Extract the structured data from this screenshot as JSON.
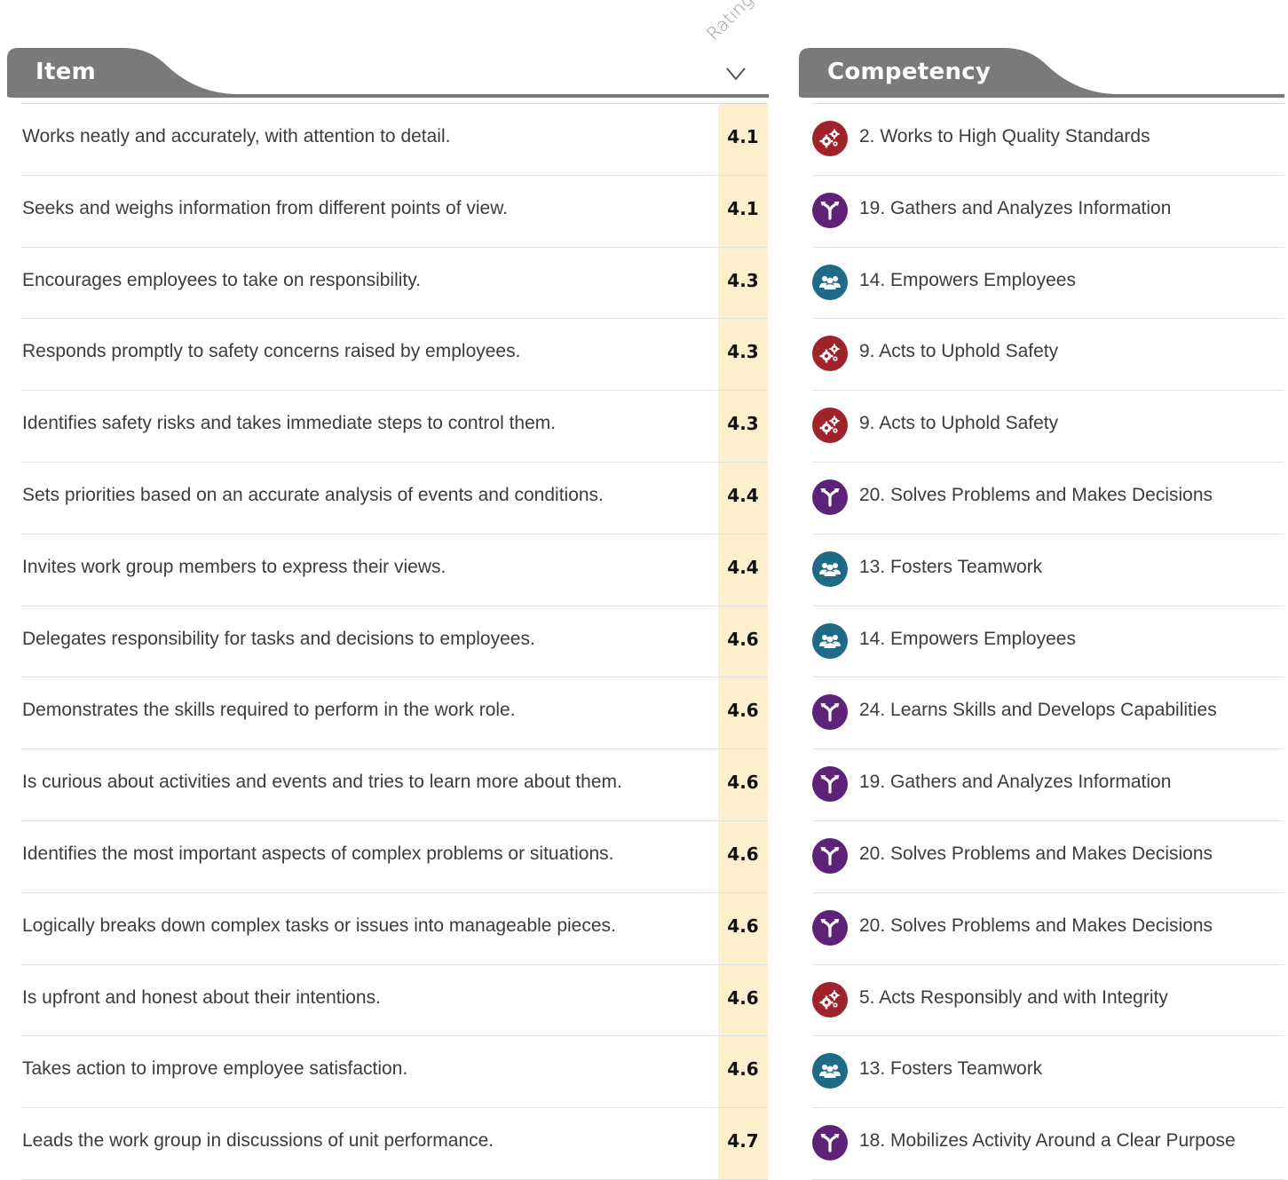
{
  "header": {
    "item_title": "Item",
    "competency_title": "Competency",
    "rating_label": "Rating",
    "sort_icon": "chevron-down-icon"
  },
  "colors": {
    "tab_gray": "#7a7a7a",
    "rating_highlight": "#fdefcc",
    "quality": "#a0222b",
    "thinking": "#5e2379",
    "people": "#1e6a87"
  },
  "rows": [
    {
      "item": "Works neatly and accurately, with attention to detail.",
      "rating": "4.1",
      "competency": "2. Works to High Quality Standards",
      "icon": "gears-icon",
      "category": "quality"
    },
    {
      "item": "Seeks and weighs information from different points of view.",
      "rating": "4.1",
      "competency": "19. Gathers and Analyzes Information",
      "icon": "fork-icon",
      "category": "thinking"
    },
    {
      "item": "Encourages employees to take on responsibility.",
      "rating": "4.3",
      "competency": "14. Empowers Employees",
      "icon": "people-icon",
      "category": "people"
    },
    {
      "item": "Responds promptly to safety concerns raised by employees.",
      "rating": "4.3",
      "competency": "9. Acts to Uphold Safety",
      "icon": "gears-icon",
      "category": "quality"
    },
    {
      "item": "Identifies safety risks and takes immediate steps to control them.",
      "rating": "4.3",
      "competency": "9. Acts to Uphold Safety",
      "icon": "gears-icon",
      "category": "quality"
    },
    {
      "item": "Sets priorities based on an accurate analysis of events and conditions.",
      "rating": "4.4",
      "competency": "20. Solves Problems and Makes Decisions",
      "icon": "fork-icon",
      "category": "thinking"
    },
    {
      "item": "Invites work group members to express their views.",
      "rating": "4.4",
      "competency": "13. Fosters Teamwork",
      "icon": "people-icon",
      "category": "people"
    },
    {
      "item": "Delegates responsibility for tasks and decisions to employees.",
      "rating": "4.6",
      "competency": "14. Empowers Employees",
      "icon": "people-icon",
      "category": "people"
    },
    {
      "item": "Demonstrates the skills required to perform in the work role.",
      "rating": "4.6",
      "competency": "24. Learns Skills and Develops Capabilities",
      "icon": "fork-icon",
      "category": "thinking"
    },
    {
      "item": "Is curious about activities and events and tries to learn more about them.",
      "rating": "4.6",
      "competency": "19. Gathers and Analyzes Information",
      "icon": "fork-icon",
      "category": "thinking"
    },
    {
      "item": "Identifies the most important aspects of complex problems or situations.",
      "rating": "4.6",
      "competency": "20. Solves Problems and Makes Decisions",
      "icon": "fork-icon",
      "category": "thinking"
    },
    {
      "item": "Logically breaks down complex tasks or issues into manageable pieces.",
      "rating": "4.6",
      "competency": "20. Solves Problems and Makes Decisions",
      "icon": "fork-icon",
      "category": "thinking"
    },
    {
      "item": "Is upfront and honest about their intentions.",
      "rating": "4.6",
      "competency": "5. Acts Responsibly and with Integrity",
      "icon": "gears-icon",
      "category": "quality"
    },
    {
      "item": "Takes action to improve employee satisfaction.",
      "rating": "4.6",
      "competency": "13. Fosters Teamwork",
      "icon": "people-icon",
      "category": "people"
    },
    {
      "item": "Leads the work group in discussions of unit performance.",
      "rating": "4.7",
      "competency": "18. Mobilizes Activity Around a Clear Purpose",
      "icon": "fork-icon",
      "category": "thinking"
    }
  ]
}
